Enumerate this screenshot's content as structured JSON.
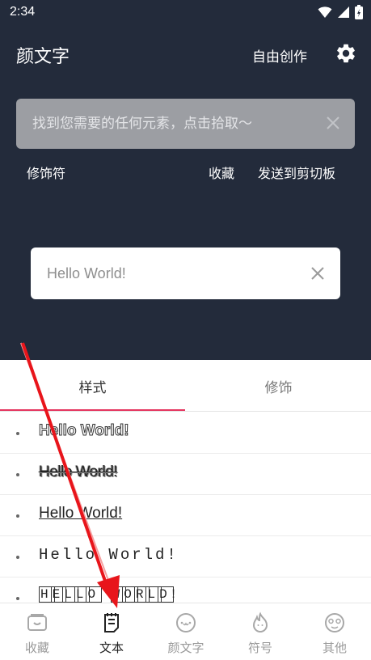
{
  "status_bar": {
    "time": "2:34"
  },
  "header": {
    "title": "颜文字",
    "create_label": "自由创作"
  },
  "search": {
    "placeholder": "找到您需要的任何元素，点击拾取～"
  },
  "actions": {
    "decorate": "修饰符",
    "favorite": "收藏",
    "copy": "发送到剪切板"
  },
  "preview": {
    "value": "Hello World!"
  },
  "tabs": [
    {
      "label": "样式",
      "active": true
    },
    {
      "label": "修饰",
      "active": false
    }
  ],
  "styles": [
    {
      "text": "Hello World!"
    },
    {
      "text": "Hello World!"
    },
    {
      "text": "Hello World!"
    },
    {
      "text": "Hello World!"
    },
    {
      "text": "HELLO WORLD!"
    }
  ],
  "bottom_nav": [
    {
      "label": "收藏",
      "icon": "bookmark-box-icon",
      "active": false
    },
    {
      "label": "文本",
      "icon": "note-icon",
      "active": true
    },
    {
      "label": "颜文字",
      "icon": "face-icon",
      "active": false
    },
    {
      "label": "符号",
      "icon": "flame-icon",
      "active": false
    },
    {
      "label": "其他",
      "icon": "emoji-icon",
      "active": false
    }
  ],
  "colors": {
    "header_bg": "#232b3b",
    "accent": "#e5355f",
    "arrow": "#e8151b"
  }
}
